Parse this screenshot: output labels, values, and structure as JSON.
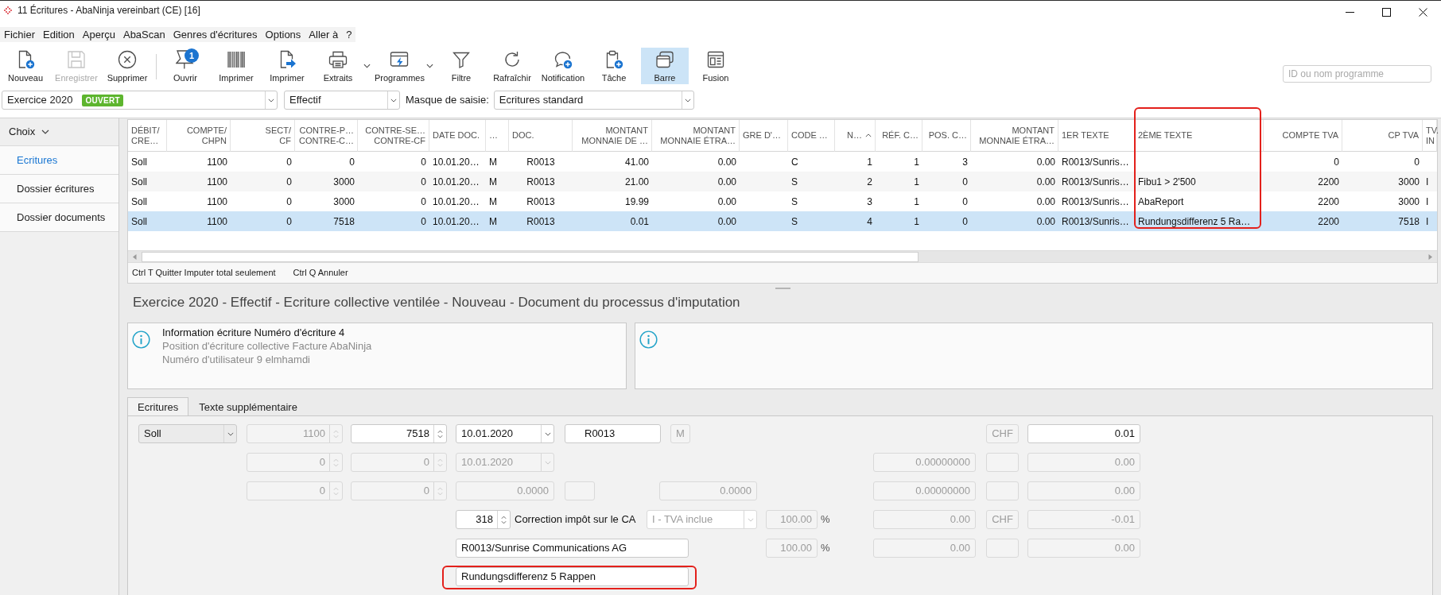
{
  "window": {
    "title": "11 Écritures - AbaNinja vereinbart (CE) [16]"
  },
  "menu": [
    "Fichier",
    "Edition",
    "Aperçu",
    "AbaScan",
    "Genres d'écritures",
    "Options",
    "Aller à",
    "?"
  ],
  "toolbar": [
    {
      "buttons": [
        {
          "label": "Nouveau",
          "disabled": false,
          "pressed": false,
          "menu": false
        },
        {
          "label": "Enregistrer",
          "disabled": true,
          "pressed": false,
          "menu": false
        },
        {
          "label": "Supprimer",
          "disabled": false,
          "pressed": false,
          "menu": false
        }
      ]
    },
    {
      "buttons": [
        {
          "label": "Ouvrir",
          "badge": "1",
          "disabled": false,
          "pressed": false,
          "menu": false
        },
        {
          "label": "Imprimer",
          "disabled": false,
          "pressed": false,
          "menu": false
        },
        {
          "label": "Imprimer",
          "disabled": false,
          "pressed": false,
          "menu": false
        },
        {
          "label": "Extraits",
          "disabled": false,
          "pressed": false,
          "menu": true
        },
        {
          "label": "Programmes",
          "disabled": false,
          "pressed": false,
          "menu": true
        },
        {
          "label": "Filtre",
          "disabled": false,
          "pressed": false,
          "menu": false
        },
        {
          "label": "Rafraîchir",
          "disabled": false,
          "pressed": false,
          "menu": false
        },
        {
          "label": "Notification",
          "disabled": false,
          "pressed": false,
          "menu": false
        },
        {
          "label": "Tâche",
          "disabled": false,
          "pressed": false,
          "menu": false
        },
        {
          "label": "Barre",
          "disabled": false,
          "pressed": true,
          "menu": false
        },
        {
          "label": "Fusion",
          "disabled": false,
          "pressed": false,
          "menu": false
        }
      ]
    }
  ],
  "search": {
    "placeholder": "ID ou nom programme"
  },
  "filters": {
    "period": {
      "value": "Exercice 2020",
      "badge": "OUVERT"
    },
    "mode": {
      "value": "Effectif"
    },
    "mask": {
      "label": "Masque de saisie:",
      "value": "Ecritures standard"
    }
  },
  "sidebar": {
    "header": {
      "label": "Choix",
      "expanded": true
    },
    "items": [
      {
        "label": "Ecritures",
        "selected": true
      },
      {
        "label": "Dossier écritures",
        "selected": false
      },
      {
        "label": "Dossier documents",
        "selected": false
      }
    ]
  },
  "table": {
    "columns": [
      {
        "lines": [
          "DÉBIT/",
          "CRE…"
        ],
        "kind": "text",
        "sorted": false,
        "highlighted": false
      },
      {
        "lines": [
          "COMPTE/",
          "CHPN"
        ],
        "kind": "number",
        "sorted": false,
        "highlighted": false
      },
      {
        "lines": [
          "SECT/",
          "CF"
        ],
        "kind": "number",
        "sorted": false,
        "highlighted": false
      },
      {
        "lines": [
          "CONTRE-P…",
          "CONTRE-C…"
        ],
        "kind": "number",
        "sorted": false,
        "highlighted": false
      },
      {
        "lines": [
          "CONTRE-SE…",
          "CONTRE-CF"
        ],
        "kind": "number",
        "sorted": false,
        "highlighted": false
      },
      {
        "lines": [
          "DATE DOC."
        ],
        "kind": "text",
        "sorted": false,
        "highlighted": false
      },
      {
        "lines": [
          "…"
        ],
        "kind": "text",
        "sorted": false,
        "highlighted": false
      },
      {
        "lines": [
          "DOC."
        ],
        "kind": "code",
        "sorted": false,
        "highlighted": false
      },
      {
        "lines": [
          "MONTANT",
          "MONNAIE DE …"
        ],
        "kind": "number",
        "sorted": false,
        "highlighted": false
      },
      {
        "lines": [
          "MONTANT",
          "MONNAIE ÉTRA…"
        ],
        "kind": "number",
        "sorted": false,
        "highlighted": false
      },
      {
        "lines": [
          "GRE D'…"
        ],
        "kind": "text",
        "sorted": false,
        "highlighted": false
      },
      {
        "lines": [
          "CODE …"
        ],
        "kind": "text",
        "sorted": false,
        "highlighted": false
      },
      {
        "lines": [
          "N…"
        ],
        "kind": "number",
        "sorted": true,
        "highlighted": false
      },
      {
        "lines": [
          "RÉF. C…"
        ],
        "kind": "number",
        "sorted": false,
        "highlighted": false
      },
      {
        "lines": [
          "POS. C…"
        ],
        "kind": "number",
        "sorted": false,
        "highlighted": false
      },
      {
        "lines": [
          "MONTANT",
          "MONNAIE ÉTRA…"
        ],
        "kind": "number",
        "sorted": false,
        "highlighted": false
      },
      {
        "lines": [
          "1ER TEXTE"
        ],
        "kind": "text",
        "sorted": false,
        "highlighted": false
      },
      {
        "lines": [
          "2ÈME TEXTE"
        ],
        "kind": "text",
        "sorted": false,
        "highlighted": true
      },
      {
        "lines": [
          "COMPTE TVA"
        ],
        "kind": "number",
        "sorted": false,
        "highlighted": false
      },
      {
        "lines": [
          "CP TVA"
        ],
        "kind": "number",
        "sorted": false,
        "highlighted": false
      },
      {
        "lines": [
          "TV.",
          "IN"
        ],
        "kind": "text",
        "sorted": false,
        "highlighted": false
      }
    ],
    "rows": [
      {
        "selected": false,
        "cells": [
          "Soll",
          "1100",
          "0",
          "0",
          "0",
          "10.01.20…",
          "M",
          "R0013",
          "41.00",
          "0.00",
          null,
          "C",
          "1",
          "1",
          "3",
          "0.00",
          "R0013/Sunris…",
          null,
          "0",
          "0",
          null
        ]
      },
      {
        "selected": false,
        "cells": [
          "Soll",
          "1100",
          "0",
          "3000",
          "0",
          "10.01.20…",
          "M",
          "R0013",
          "21.00",
          "0.00",
          null,
          "S",
          "2",
          "1",
          "0",
          "0.00",
          "R0013/Sunris…",
          "Fibu1 > 2'500",
          "2200",
          "3000",
          "I"
        ]
      },
      {
        "selected": false,
        "cells": [
          "Soll",
          "1100",
          "0",
          "3000",
          "0",
          "10.01.20…",
          "M",
          "R0013",
          "19.99",
          "0.00",
          null,
          "S",
          "3",
          "1",
          "0",
          "0.00",
          "R0013/Sunris…",
          "AbaReport",
          "2200",
          "3000",
          "I"
        ]
      },
      {
        "selected": true,
        "cells": [
          "Soll",
          "1100",
          "0",
          "7518",
          "0",
          "10.01.20…",
          "M",
          "R0013",
          "0.01",
          "0.00",
          null,
          "S",
          "4",
          "1",
          "0",
          "0.00",
          "R0013/Sunris…",
          "Rundungsdifferenz 5 Ra…",
          "2200",
          "7518",
          "I"
        ]
      }
    ],
    "footer": [
      "Ctrl T Quitter Imputer total seulement",
      "Ctrl Q Annuler"
    ]
  },
  "heading": "Exercice 2020 - Effectif - Ecriture collective ventilée - Nouveau - Document du processus d'imputation",
  "info_panel": {
    "lines": [
      {
        "text": "Information écriture Numéro d'écriture 4",
        "kind": "heading"
      },
      {
        "text": "Position d'écriture collective Facture AbaNinja",
        "kind": "detail"
      },
      {
        "text": "Numéro d'utilisateur 9 elmhamdi",
        "kind": "detail"
      }
    ]
  },
  "form": {
    "tabs": [
      {
        "label": "Ecritures",
        "selected": true
      },
      {
        "label": "Texte supplémentaire",
        "selected": false
      }
    ],
    "rows": [
      {
        "fields": [
          {
            "kind": "select",
            "value": "Soll",
            "disabled": false,
            "highlighted": false
          },
          {
            "kind": "spin",
            "value": "1100",
            "disabled": true,
            "highlighted": false
          },
          {
            "kind": "spin",
            "value": "7518",
            "disabled": false,
            "highlighted": false
          },
          {
            "kind": "combo",
            "value": "10.01.2020",
            "disabled": false,
            "highlighted": false
          },
          {
            "kind": "reference",
            "value": "R0013",
            "disabled": false,
            "highlighted": false
          },
          {
            "kind": "code",
            "value": "M",
            "disabled": true,
            "highlighted": false
          },
          {
            "kind": "code",
            "value": "CHF",
            "disabled": true,
            "highlighted": false
          },
          {
            "kind": "number",
            "value": "0.01",
            "disabled": false,
            "highlighted": false
          }
        ]
      },
      {
        "fields": [
          {
            "kind": "spin",
            "value": "0",
            "disabled": true,
            "highlighted": false
          },
          {
            "kind": "spin",
            "value": "0",
            "disabled": true,
            "highlighted": false
          },
          {
            "kind": "combo",
            "value": "10.01.2020",
            "disabled": true,
            "highlighted": false
          },
          {
            "kind": "number",
            "value": "0.00000000",
            "disabled": true,
            "highlighted": false
          },
          {
            "kind": "code",
            "disabled": true,
            "highlighted": false
          },
          {
            "kind": "number",
            "value": "0.00",
            "disabled": true,
            "highlighted": false
          }
        ]
      },
      {
        "fields": [
          {
            "kind": "spin",
            "value": "0",
            "disabled": true,
            "highlighted": false
          },
          {
            "kind": "spin",
            "value": "0",
            "disabled": true,
            "highlighted": false
          },
          {
            "kind": "number",
            "value": "0.0000",
            "disabled": true,
            "highlighted": false
          },
          {
            "kind": "code",
            "disabled": true,
            "highlighted": false
          },
          {
            "kind": "number",
            "value": "0.0000",
            "disabled": true,
            "highlighted": false
          },
          {
            "kind": "number",
            "value": "0.00000000",
            "disabled": true,
            "highlighted": false
          },
          {
            "kind": "code",
            "disabled": true,
            "highlighted": false
          },
          {
            "kind": "number",
            "value": "0.00",
            "disabled": true,
            "highlighted": false
          }
        ]
      },
      {
        "fields": [
          {
            "kind": "spin",
            "value": "318",
            "disabled": false,
            "highlighted": false
          },
          {
            "kind": "label",
            "value": "Correction impôt sur le CA",
            "disabled": false,
            "highlighted": false
          },
          {
            "kind": "select",
            "value": "I - TVA inclue",
            "disabled": true,
            "highlighted": false
          },
          {
            "kind": "number",
            "value": "100.00",
            "disabled": true,
            "highlighted": false
          },
          {
            "kind": "unit",
            "value": "%",
            "disabled": false,
            "highlighted": false
          },
          {
            "kind": "number",
            "value": "0.00",
            "disabled": true,
            "highlighted": false
          },
          {
            "kind": "code",
            "value": "CHF",
            "disabled": true,
            "highlighted": false
          },
          {
            "kind": "number",
            "value": "-0.01",
            "disabled": true,
            "highlighted": false
          }
        ]
      },
      {
        "fields": [
          {
            "kind": "text",
            "value": "R0013/Sunrise Communications AG",
            "disabled": false,
            "highlighted": false
          },
          {
            "kind": "number",
            "value": "100.00",
            "disabled": true,
            "highlighted": false
          },
          {
            "kind": "unit",
            "value": "%",
            "disabled": false,
            "highlighted": false
          },
          {
            "kind": "number",
            "value": "0.00",
            "disabled": true,
            "highlighted": false
          },
          {
            "kind": "code",
            "disabled": true,
            "highlighted": false
          },
          {
            "kind": "number",
            "value": "0.00",
            "disabled": true,
            "highlighted": false
          }
        ]
      },
      {
        "fields": [
          {
            "kind": "text",
            "value": "Rundungsdifferenz 5 Rappen",
            "disabled": false,
            "highlighted": true
          }
        ]
      }
    ]
  }
}
